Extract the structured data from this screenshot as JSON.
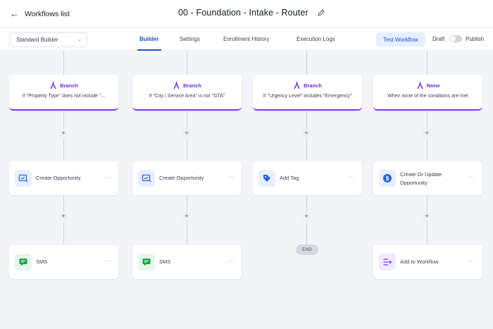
{
  "header": {
    "back_label": "Workflows list",
    "title": "00 - Foundation - Intake - Router"
  },
  "toolbar": {
    "builder_select": "Standard Builder",
    "tabs": [
      {
        "label": "Builder",
        "active": true
      },
      {
        "label": "Settings",
        "active": false
      },
      {
        "label": "Enrollment History",
        "active": false
      },
      {
        "label": "Execution Logs",
        "active": false
      }
    ],
    "test_button": "Test Workflow",
    "draft_label": "Draft",
    "publish_label": "Publish",
    "published": false
  },
  "branches": [
    {
      "type": "Branch",
      "condition": "If \"Property Type\" does not include \"...",
      "actions": [
        {
          "label": "Create Opportunity",
          "icon": "opportunity-icon"
        },
        {
          "label": "SMS",
          "icon": "sms-icon"
        }
      ]
    },
    {
      "type": "Branch",
      "condition": "If \"City / Service Area\" is not \"GTA\"",
      "actions": [
        {
          "label": "Create Opportunity",
          "icon": "opportunity-icon"
        },
        {
          "label": "SMS",
          "icon": "sms-icon"
        }
      ]
    },
    {
      "type": "Branch",
      "condition": "If \"Urgency Level\" includes \"Emergency\"",
      "actions": [
        {
          "label": "Add Tag",
          "icon": "tag-icon"
        }
      ],
      "end_label": "END"
    },
    {
      "type": "None",
      "condition": "When none of the conditions are met",
      "actions": [
        {
          "label": "Create Or Update Opportunity",
          "icon": "dollar-icon"
        },
        {
          "label": "Add to Workflow",
          "icon": "add-to-workflow-icon"
        }
      ]
    }
  ],
  "colors": {
    "accent": "#1d4ed8",
    "branch": "#7c3aed",
    "sms": "#16a34a",
    "action_blue": "#2563eb"
  }
}
